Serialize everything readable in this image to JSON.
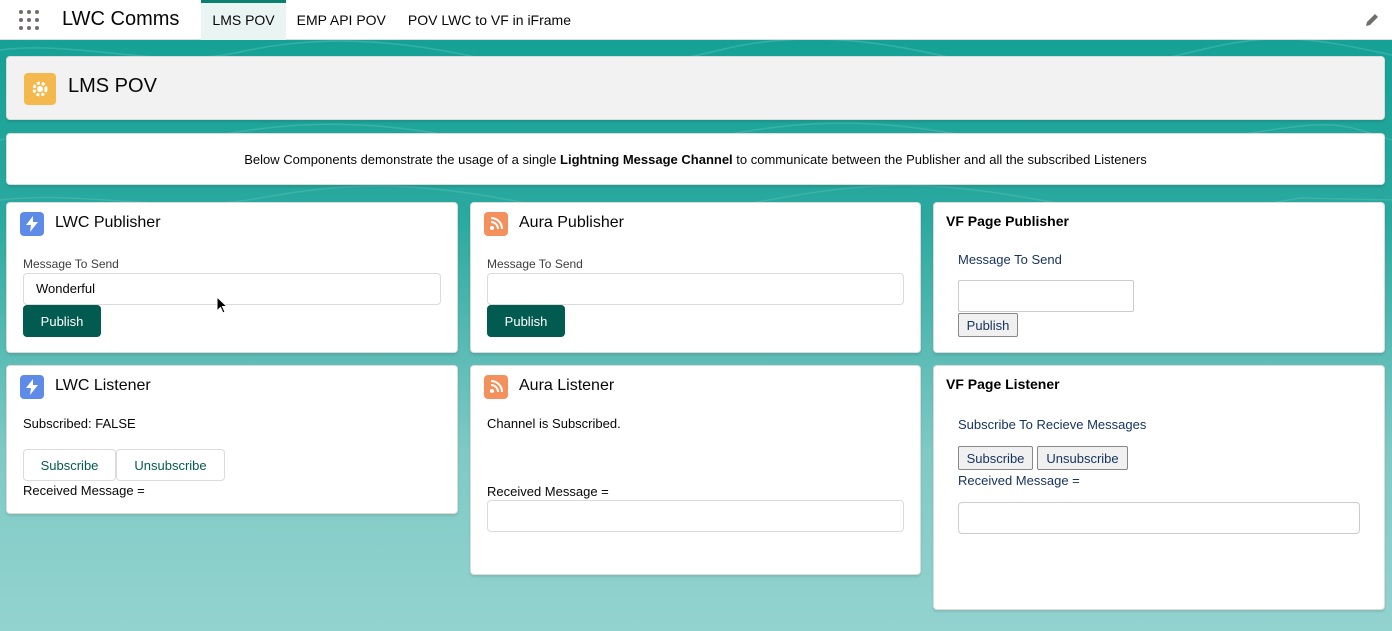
{
  "topnav": {
    "app_name": "LWC Comms",
    "tabs": [
      {
        "label": "LMS POV",
        "active": true
      },
      {
        "label": "EMP API POV",
        "active": false
      },
      {
        "label": "POV LWC to VF in iFrame",
        "active": false
      }
    ]
  },
  "header": {
    "title": "LMS POV",
    "icon": "settings-gear-icon",
    "icon_color": "#f4b84c"
  },
  "description": {
    "prefix": "Below Components demonstrate the usage of a single ",
    "bold": "Lightning Message Channel",
    "suffix": " to communicate between the Publisher and all the subscribed Listeners"
  },
  "lwc_publisher": {
    "title": "LWC Publisher",
    "field_label": "Message To Send",
    "field_value": "Wonderful",
    "button": "Publish"
  },
  "aura_publisher": {
    "title": "Aura Publisher",
    "field_label": "Message To Send",
    "field_value": "",
    "button": "Publish"
  },
  "vf_publisher": {
    "title": "VF Page Publisher",
    "field_label": "Message To Send",
    "button": "Publish"
  },
  "lwc_listener": {
    "title": "LWC Listener",
    "status": "Subscribed: FALSE",
    "subscribe_button": "Subscribe",
    "unsubscribe_button": "Unsubscribe",
    "received_label": "Received Message ="
  },
  "aura_listener": {
    "title": "Aura Listener",
    "status": "Channel is Subscribed.",
    "received_label": "Received Message ="
  },
  "vf_listener": {
    "title": "VF Page Listener",
    "prompt": "Subscribe To Recieve Messages",
    "subscribe_button": "Subscribe",
    "unsubscribe_button": "Unsubscribe",
    "received_label": "Received Message ="
  },
  "colors": {
    "brand": "#025b51",
    "lwc_icon": "#5e8be8",
    "aura_icon": "#f3905b",
    "active_tab_border": "#0b7f71"
  }
}
